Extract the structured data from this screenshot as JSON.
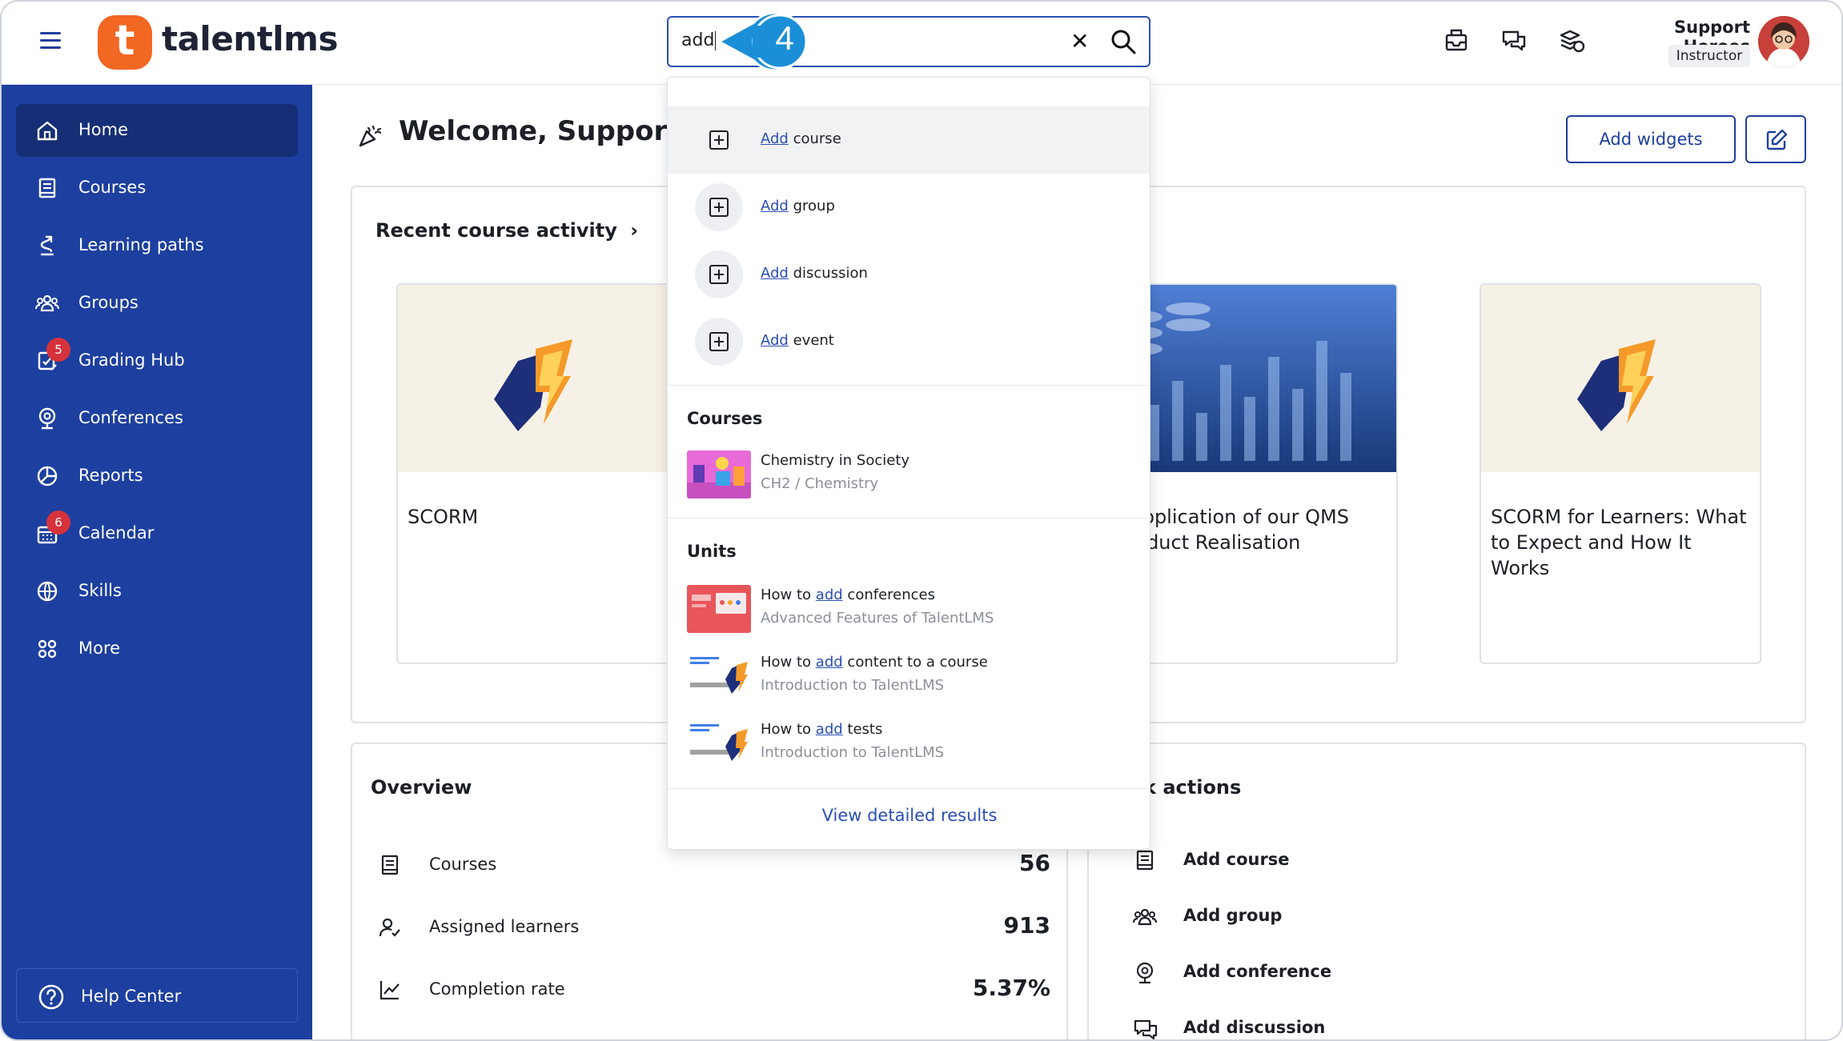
{
  "app": {
    "logo_text": "talentlms",
    "logo_letter": "t"
  },
  "search": {
    "value": "add",
    "step_number": "4"
  },
  "user": {
    "name": "Support Heroes",
    "role": "Instructor"
  },
  "header_icons": [
    "inbox-icon",
    "chat-icon",
    "credits-icon"
  ],
  "sidebar": {
    "items": [
      {
        "label": "Home",
        "icon": "home-icon",
        "active": true
      },
      {
        "label": "Courses",
        "icon": "book-icon"
      },
      {
        "label": "Learning paths",
        "icon": "path-icon"
      },
      {
        "label": "Groups",
        "icon": "group-icon"
      },
      {
        "label": "Grading Hub",
        "icon": "grading-icon",
        "badge": "5"
      },
      {
        "label": "Conferences",
        "icon": "webcam-icon"
      },
      {
        "label": "Reports",
        "icon": "pie-chart-icon"
      },
      {
        "label": "Calendar",
        "icon": "calendar-icon",
        "badge": "6"
      },
      {
        "label": "Skills",
        "icon": "skills-icon"
      },
      {
        "label": "More",
        "icon": "grid-icon"
      }
    ],
    "help": "Help Center"
  },
  "main": {
    "welcome": "Welcome, Support!",
    "add_widgets": "Add widgets",
    "recent_activity_title": "Recent course activity",
    "cards": [
      {
        "name": "SCORM"
      },
      {
        "name": "- Application of our QMS Product Realisation"
      },
      {
        "name": "SCORM for Learners: What to Expect and How It Works"
      }
    ],
    "overview": {
      "title": "Overview",
      "rows": [
        {
          "label": "Courses",
          "value": "56"
        },
        {
          "label": "Assigned learners",
          "value": "913"
        },
        {
          "label": "Completion rate",
          "value": "5.37%"
        }
      ]
    },
    "quick_actions": {
      "title": "k actions",
      "rows": [
        {
          "label": "Add course"
        },
        {
          "label": "Add group"
        },
        {
          "label": "Add conference"
        },
        {
          "label": "Add discussion"
        }
      ]
    }
  },
  "dropdown": {
    "actions": [
      {
        "match": "Add",
        "rest": "course"
      },
      {
        "match": "Add",
        "rest": "group"
      },
      {
        "match": "Add",
        "rest": "discussion"
      },
      {
        "match": "Add",
        "rest": "event"
      }
    ],
    "courses_heading": "Courses",
    "courses": [
      {
        "title": "Chemistry in Society",
        "sub": "CH2 / Chemistry"
      }
    ],
    "units_heading": "Units",
    "units": [
      {
        "pre": "How to ",
        "match": "add",
        "post": "conferences",
        "sub": "Advanced Features of TalentLMS"
      },
      {
        "pre": "How to ",
        "match": "add",
        "post": "content to a course",
        "sub": "Introduction to TalentLMS"
      },
      {
        "pre": "How to ",
        "match": "add",
        "post": "tests",
        "sub": "Introduction to TalentLMS"
      }
    ],
    "footer": "View detailed results"
  },
  "colors": {
    "brand_blue": "#1d3f9f",
    "brand_orange": "#f26722",
    "link_blue": "#2b4fb4"
  }
}
